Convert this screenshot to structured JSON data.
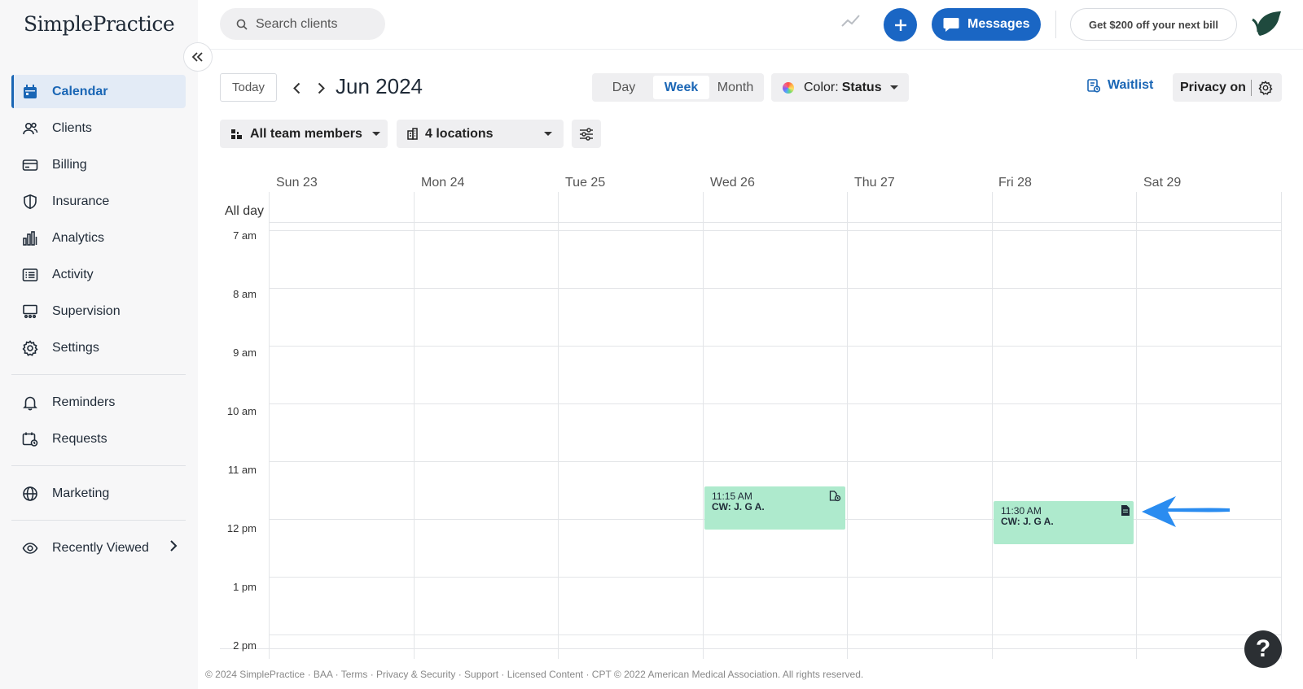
{
  "brand": {
    "name": "SimplePractice"
  },
  "sidebar": {
    "items": [
      {
        "label": "Calendar",
        "icon": "calendar-icon",
        "active": true
      },
      {
        "label": "Clients",
        "icon": "clients-icon"
      },
      {
        "label": "Billing",
        "icon": "billing-icon"
      },
      {
        "label": "Insurance",
        "icon": "shield-icon"
      },
      {
        "label": "Analytics",
        "icon": "analytics-icon"
      },
      {
        "label": "Activity",
        "icon": "activity-icon"
      },
      {
        "label": "Supervision",
        "icon": "supervision-icon"
      },
      {
        "label": "Settings",
        "icon": "gear-icon"
      }
    ],
    "secondary": [
      {
        "label": "Reminders",
        "icon": "bell-icon"
      },
      {
        "label": "Requests",
        "icon": "requests-icon"
      }
    ],
    "tertiary": [
      {
        "label": "Marketing",
        "icon": "globe-icon"
      }
    ],
    "recently_viewed": "Recently Viewed"
  },
  "topbar": {
    "search_placeholder": "Search clients",
    "messages_label": "Messages",
    "promo_label": "Get $200 off your next bill"
  },
  "toolbar": {
    "today_label": "Today",
    "month_title": "Jun 2024",
    "views": [
      "Day",
      "Week",
      "Month"
    ],
    "active_view": "Week",
    "color_label": "Color:",
    "color_value": "Status",
    "waitlist_label": "Waitlist",
    "privacy_label": "Privacy on",
    "team_label": "All team members",
    "locations_label": "4 locations"
  },
  "calendar": {
    "days": [
      "Sun 23",
      "Mon 24",
      "Tue 25",
      "Wed 26",
      "Thu 27",
      "Fri 28",
      "Sat 29"
    ],
    "all_day_label": "All day",
    "hours": [
      "7 am",
      "8 am",
      "9 am",
      "10 am",
      "11 am",
      "12 pm",
      "1 pm",
      "2 pm"
    ],
    "events": [
      {
        "day": "Wed 26",
        "time": "11:15 AM",
        "client": "CW: J. G A.",
        "icon": "document-clock-icon",
        "color": "#aeeacd"
      },
      {
        "day": "Fri 28",
        "time": "11:30 AM",
        "client": "CW: J. G A.",
        "icon": "note-icon",
        "color": "#aeeacd"
      }
    ]
  },
  "help_label": "?",
  "footer": "© 2024 SimplePractice · BAA · Terms · Privacy & Security · Support · Licensed Content · CPT © 2022 American Medical Association. All rights reserved.",
  "colors": {
    "accent": "#1a66c4",
    "event": "#aeeacd",
    "active_nav_bg": "#e3ebf6"
  }
}
